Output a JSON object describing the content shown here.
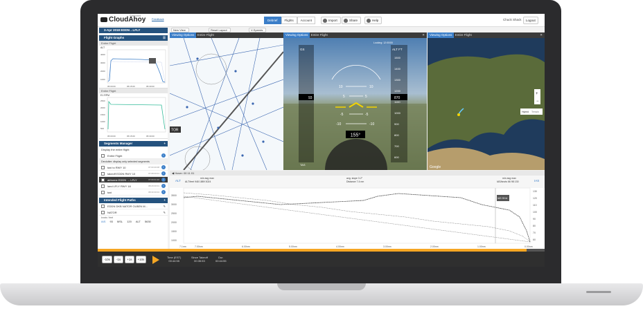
{
  "app": {
    "title": "CloudAhoy",
    "subtitle": "Standard",
    "feedback": "Feedback"
  },
  "topbar": {
    "tabs": [
      "Debrief",
      "Flights",
      "Account"
    ],
    "buttons": {
      "import": "Import",
      "share": "Share",
      "help": "Help"
    },
    "user": "Chuck Shack",
    "logout": "Logout"
  },
  "left": {
    "flight_header": "3-Apr 2018 EDDN→LFLY",
    "flight_graphs": "Flight Graphs",
    "entire_flight": "Entire Flight",
    "unit_alt": "ALT",
    "unit_rpm": "E1 RPM",
    "alt_ticks": [
      "4000",
      "3000",
      "2000",
      "1000"
    ],
    "rpm_ticks": [
      "2500",
      "2000",
      "1500",
      "1000",
      "500"
    ],
    "time_ticks": [
      "05:00:00",
      "05:15:00",
      "05:30:00"
    ],
    "segments_manager": "Segments Manager",
    "display_entire": "Display the entire flight",
    "declutter": "Declutter: display only selected segments",
    "segments": [
      {
        "label": "taxi to RWY 10",
        "meta": "07:00 00:08"
      },
      {
        "label": "takeoff EDDN RWY 10",
        "meta": "07:08 00:01"
      },
      {
        "label": "airborne EDDN → LFLY",
        "meta": "07:09 01:20"
      },
      {
        "label": "land LFLY RWY 18",
        "meta": "08:29 00:01"
      },
      {
        "label": "taxi",
        "meta": "08:30 00:04"
      }
    ],
    "intended_paths": "Intended Flight Paths",
    "paths": [
      "EDDN DKB NATOR OLBEN M...",
      "NATOR"
    ],
    "knots_label": "knots / feet",
    "ias_label": "IAS",
    "alt_label": "ALT",
    "msl_label": "MSL",
    "ias_val": "93",
    "ias_ref": "120",
    "alt_val": "5630"
  },
  "panels": {
    "viewing_options": "Viewing Options",
    "entire_flight": "Entire Flight",
    "new_view": "New View",
    "reset_layout": "Reset Layout",
    "v_speeds": "V-Speeds",
    "tor_label": "TOR",
    "looking": "Looking: 12:00/00",
    "heading": "155°",
    "gs_label": "GS",
    "gs_val": "93",
    "alt_ft": "ALT FT",
    "alt_val": "870",
    "tas_label": "TAS",
    "pitch_labels": [
      "10",
      "5",
      "-5",
      "-10"
    ],
    "alt_tape": [
      "1500",
      "1400",
      "1300",
      "1200",
      "1100",
      "1000",
      "900",
      "800",
      "700",
      "600"
    ],
    "map_tabs": [
      "Hybrid",
      "Terrain"
    ],
    "google": "Google"
  },
  "profile": {
    "header": "◀ Hover: 00 11 01",
    "left_axis_unit": "ALT",
    "left_ticks": [
      "3500",
      "3000",
      "2500",
      "2000",
      "1500",
      "1000"
    ],
    "right_axis_unit": "IAS",
    "right_ticks": [
      "130",
      "120",
      "110",
      "100",
      "90",
      "80",
      "70",
      "60"
    ],
    "alt_stats": "min avg max",
    "alt_stats_vals": "ALT/feet 948 1889 3024",
    "slope": "avg. slope 3.2°",
    "distance": "Distance 7.4 nm",
    "ias_stats": "min avg max",
    "ias_stats_vals": "IAS/knots 66 98 130",
    "x_ticks": [
      "7.1nm",
      "7.00nm",
      "6.00nm",
      "5.00nm",
      "4.00nm",
      "3.00nm",
      "2.00nm",
      "1.00nm",
      "0.00nm"
    ],
    "marker_ias": "IAS 93 kt"
  },
  "timeline": {
    "steps": [
      "-10s",
      "-1s",
      "+1s",
      "+10s"
    ],
    "time_label": "Time (EST)",
    "time_val": "00:44:55",
    "since_label": "Since Takeoff",
    "since_val": "00:35:53",
    "dur_label": "Dur.",
    "dur_val": "00:44:55",
    "progress": 0.96
  },
  "colors": {
    "accent": "#3b7ec8",
    "dark_header": "#24527e",
    "timeline": "#f5a623",
    "bezel": "#2b2b2d"
  }
}
